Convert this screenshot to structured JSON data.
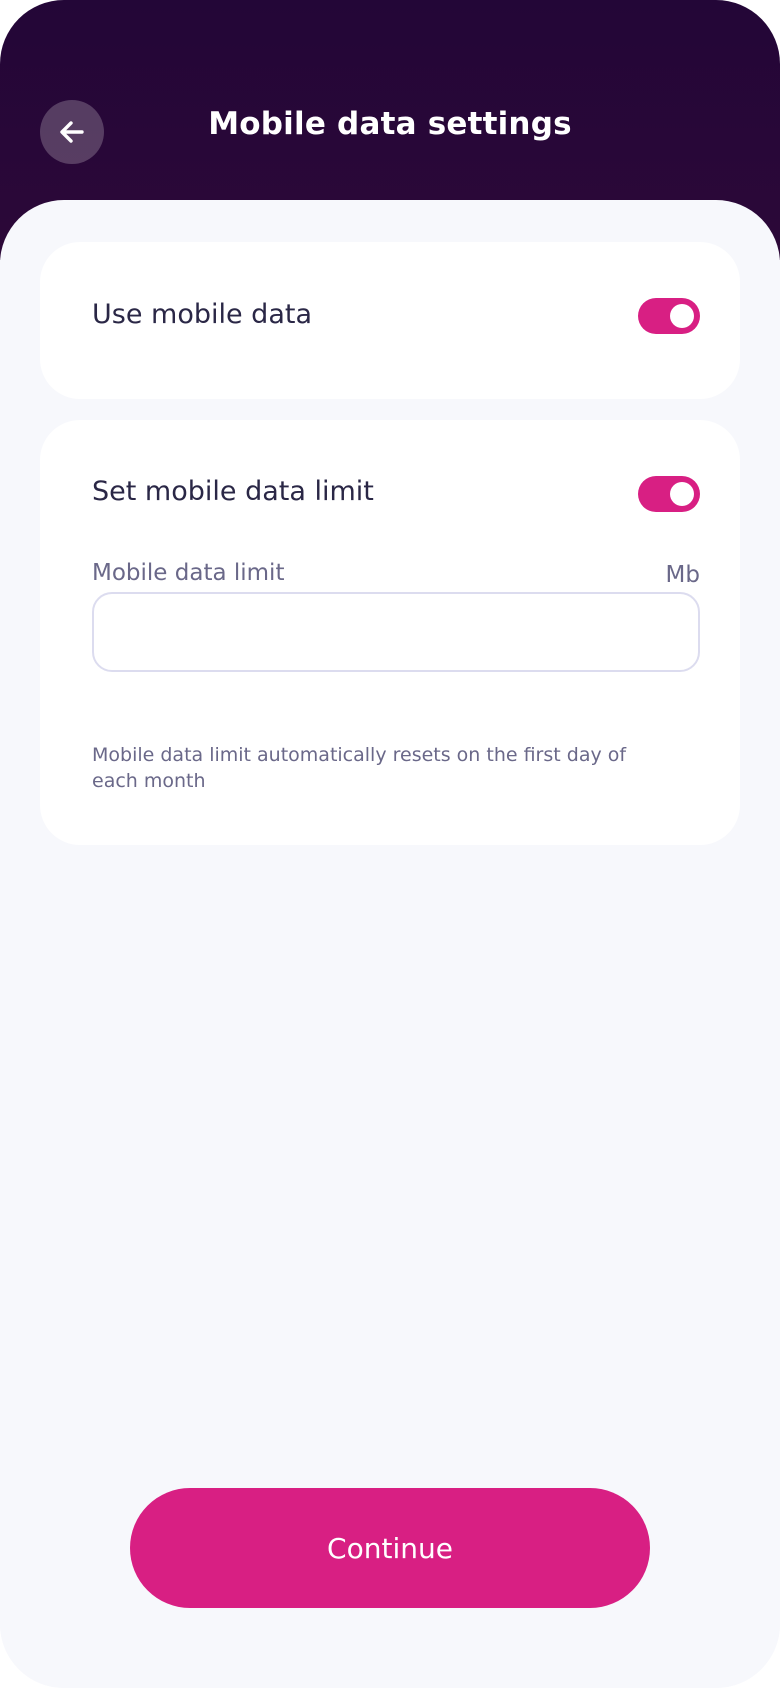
{
  "header": {
    "title": "Mobile data settings",
    "back_icon": "arrow-left-icon"
  },
  "settings": {
    "use_mobile_data": {
      "label": "Use mobile data",
      "enabled": true
    },
    "data_limit": {
      "label": "Set mobile data limit",
      "enabled": true,
      "field_label": "Mobile data limit",
      "unit": "Mb",
      "value": "",
      "placeholder": "",
      "helper": "Mobile data limit automatically resets on the first day of each month"
    }
  },
  "footer": {
    "continue_label": "Continue"
  },
  "colors": {
    "header_bg": "#230637",
    "accent": "#d81f83",
    "background": "#f7f8fc",
    "card": "#ffffff",
    "text_primary": "#2a2746",
    "text_secondary": "#6a6889"
  }
}
